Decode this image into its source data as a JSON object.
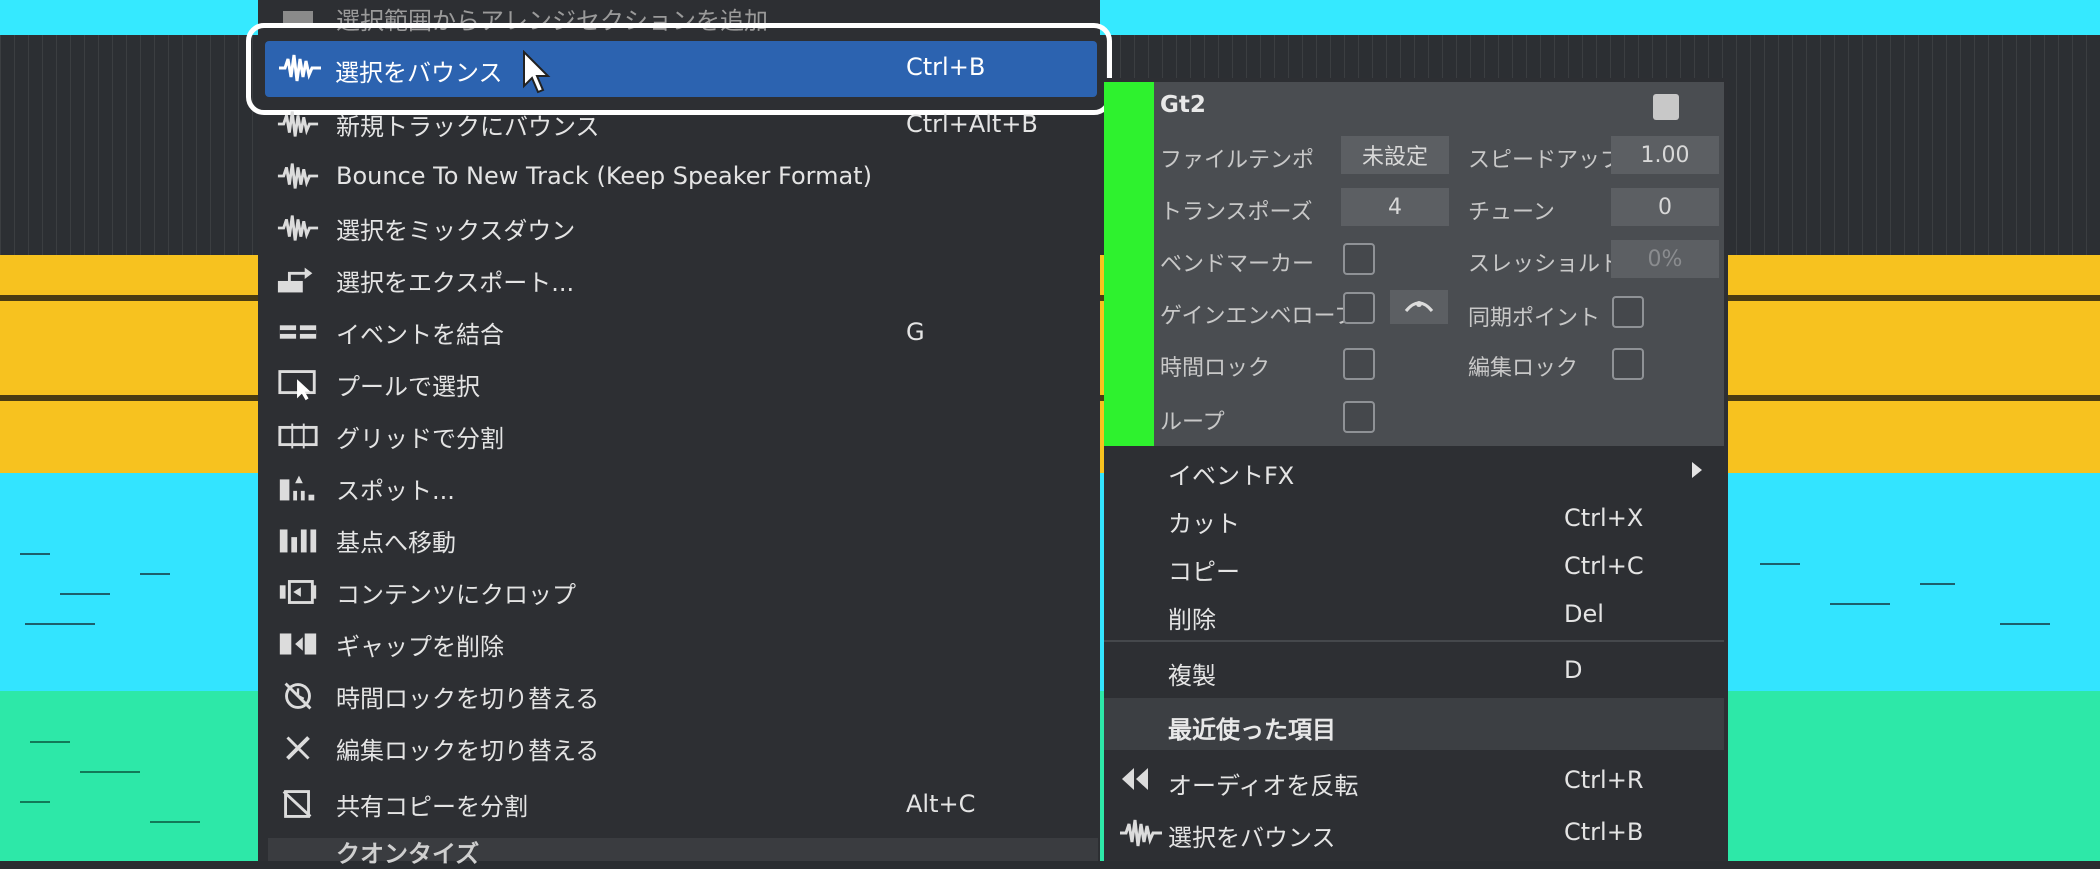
{
  "left_menu": {
    "items": [
      {
        "label": "選択範囲からアレンジセクションを追加",
        "shortcut": "",
        "icon": "arrange-section-icon"
      },
      {
        "label": "選択をバウンス",
        "shortcut": "Ctrl+B",
        "icon": "waveform-icon"
      },
      {
        "label": "新規トラックにバウンス",
        "shortcut": "Ctrl+Alt+B",
        "icon": "waveform-icon"
      },
      {
        "label": "Bounce To New Track (Keep Speaker Format)",
        "shortcut": "",
        "icon": "waveform-icon"
      },
      {
        "label": "選択をミックスダウン",
        "shortcut": "",
        "icon": "waveform-icon"
      },
      {
        "label": "選択をエクスポート...",
        "shortcut": "",
        "icon": "export-icon"
      },
      {
        "label": "イベントを結合",
        "shortcut": "G",
        "icon": "merge-events-icon"
      },
      {
        "label": "プールで選択",
        "shortcut": "",
        "icon": "pool-select-icon"
      },
      {
        "label": "グリッドで分割",
        "shortcut": "",
        "icon": "split-grid-icon"
      },
      {
        "label": "スポット...",
        "shortcut": "",
        "icon": "spot-icon"
      },
      {
        "label": "基点へ移動",
        "shortcut": "",
        "icon": "move-to-origin-icon"
      },
      {
        "label": "コンテンツにクロップ",
        "shortcut": "",
        "icon": "crop-content-icon"
      },
      {
        "label": "ギャップを削除",
        "shortcut": "",
        "icon": "delete-gap-icon"
      },
      {
        "label": "時間ロックを切り替える",
        "shortcut": "",
        "icon": "time-lock-icon"
      },
      {
        "label": "編集ロックを切り替える",
        "shortcut": "",
        "icon": "edit-lock-icon"
      },
      {
        "label": "共有コピーを分割",
        "shortcut": "Alt+C",
        "icon": "shared-copy-icon"
      }
    ],
    "bottom_section": "クオンタイズ"
  },
  "event_info": {
    "title": "Gt2",
    "file_tempo_label": "ファイルテンポ",
    "file_tempo_value": "未設定",
    "speedup_label": "スピードアップ",
    "speedup_value": "1.00",
    "transpose_label": "トランスポーズ",
    "transpose_value": "4",
    "tune_label": "チューン",
    "tune_value": "0",
    "bend_marker_label": "ベンドマーカー",
    "threshold_label": "スレッショルド",
    "threshold_value": "0%",
    "gain_envelope_label": "ゲインエンベロープ",
    "sync_point_label": "同期ポイント",
    "time_lock_label": "時間ロック",
    "edit_lock_label": "編集ロック",
    "loop_label": "ループ"
  },
  "right_menu": {
    "event_fx": "イベントFX",
    "cut": {
      "label": "カット",
      "shortcut": "Ctrl+X"
    },
    "copy": {
      "label": "コピー",
      "shortcut": "Ctrl+C"
    },
    "delete": {
      "label": "削除",
      "shortcut": "Del"
    },
    "duplicate": {
      "label": "複製",
      "shortcut": "D"
    },
    "recent_header": "最近使った項目",
    "reverse_audio": {
      "label": "オーディオを反転",
      "shortcut": "Ctrl+R"
    },
    "bounce_selection": {
      "label": "選択をバウンス",
      "shortcut": "Ctrl+B"
    }
  },
  "colors": {
    "highlight": "#2c63b0",
    "event_color": "#2ef22e",
    "lane_cyan": "#35e9ff",
    "lane_yellow": "#f7c21f",
    "lane_teal": "#2de8a8"
  }
}
